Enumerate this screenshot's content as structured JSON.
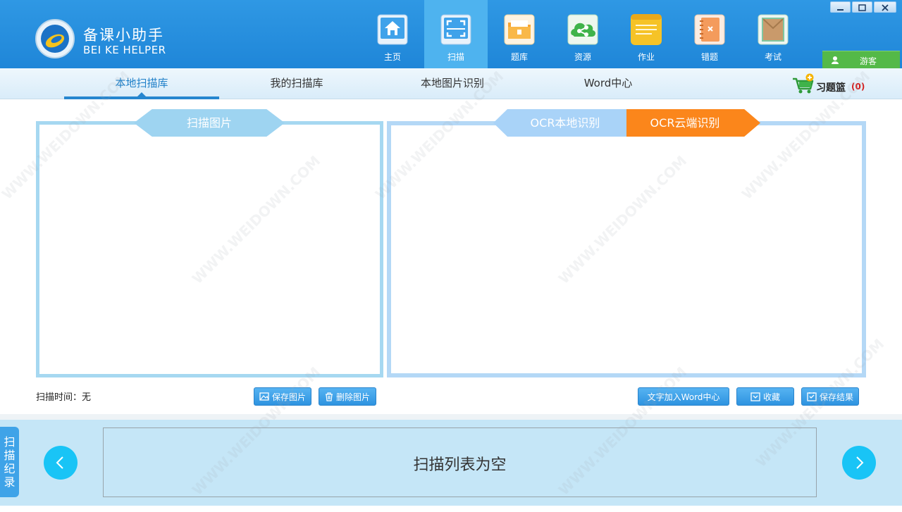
{
  "app": {
    "name": "备课小助手",
    "name_en": "BEI KE HELPER"
  },
  "nav": [
    {
      "label": "主页",
      "icon": "home-icon",
      "color": "#3fa2ea"
    },
    {
      "label": "扫描",
      "icon": "scan-icon",
      "color": "#3fa2ea",
      "active": true
    },
    {
      "label": "题库",
      "icon": "folder-icon",
      "color": "#f7a531"
    },
    {
      "label": "资源",
      "icon": "share-icon",
      "color": "#3fb34a"
    },
    {
      "label": "作业",
      "icon": "notepad-icon",
      "color": "#f6c327"
    },
    {
      "label": "错题",
      "icon": "notebook-icon",
      "color": "#f49b5c"
    },
    {
      "label": "考试",
      "icon": "envelope-icon",
      "color": "#7fc7a1"
    }
  ],
  "user": {
    "label": "游客"
  },
  "tabs": [
    {
      "label": "本地扫描库",
      "active": true
    },
    {
      "label": "我的扫描库"
    },
    {
      "label": "本地图片识别"
    },
    {
      "label": "Word中心"
    }
  ],
  "basket": {
    "label": "习题篮",
    "count": "(0)"
  },
  "left_panel": {
    "title": "扫描图片"
  },
  "right_panel": {
    "ocr_local": "OCR本地识别",
    "ocr_cloud": "OCR云端识别"
  },
  "scan_time": "扫描时间：无",
  "buttons": {
    "save_image": "保存图片",
    "delete_image": "删除图片",
    "add_to_word": "文字加入Word中心",
    "collect": "收藏",
    "save_result": "保存结果"
  },
  "record_tab": [
    "扫",
    "描",
    "纪",
    "录"
  ],
  "list": {
    "empty_text": "扫描列表为空"
  },
  "watermark": "WWW.WEIDOWN.COM",
  "colors": {
    "header": "#2390dd",
    "active_tab": "#2686cf",
    "ocr_cloud": "#fb861b",
    "guest": "#54b948"
  }
}
